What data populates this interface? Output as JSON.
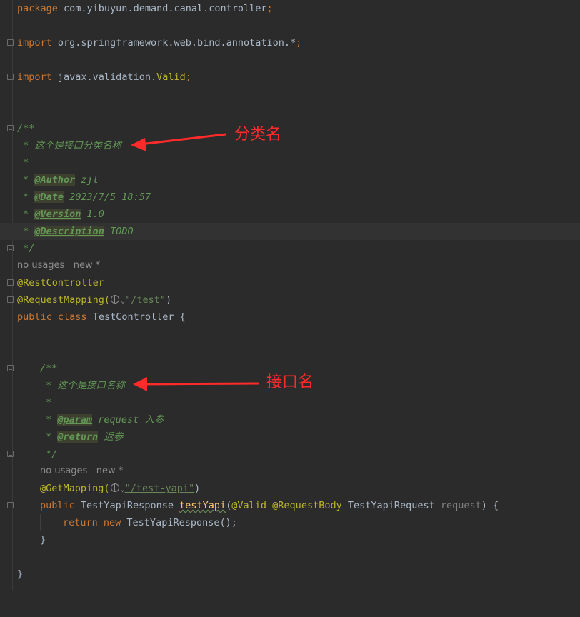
{
  "code": {
    "package_line": "package com.yibuyun.demand.canal.controller;",
    "import1_kw": "import",
    "import1_rest": " org.springframework.web.bind.annotation.*;",
    "import2_kw": "import",
    "import2_pkg": " javax.validation.",
    "import2_cls": "Valid",
    "import2_end": ";",
    "doc_open": "/**",
    "doc_desc": " * 这个是接口分类名称",
    "doc_blank": " *",
    "doc_author_prefix": " * ",
    "doc_author_tag": "@Author",
    "doc_author_val": " zjl",
    "doc_date_tag": "@Date",
    "doc_date_val": " 2023/7/5 18:57",
    "doc_version_tag": "@Version",
    "doc_version_val": " 1.0",
    "doc_descr_tag": "@Description",
    "doc_descr_val": " TODO",
    "doc_close": " */",
    "usages_hint": "no usages",
    "new_hint": "new *",
    "rest_controller": "@RestController",
    "request_mapping": "@RequestMapping(",
    "request_mapping_path": "\"/test\"",
    "request_mapping_end": ")",
    "class_kw1": "public",
    "class_kw2": "class",
    "class_name": " TestController {",
    "m_doc_open": "/**",
    "m_doc_desc": " * 这个是接口名称",
    "m_doc_blank": " *",
    "m_param_tag": "@param",
    "m_param_val": " request 入参",
    "m_return_tag": "@return",
    "m_return_val": " 返参",
    "m_doc_close": " */",
    "m_usages_hint": "no usages",
    "m_new_hint": "new *",
    "get_mapping": "@GetMapping(",
    "get_mapping_path": "\"/test-yapi\"",
    "get_mapping_end": ")",
    "method_kw": "public",
    "method_ret": " TestYapiResponse ",
    "method_name": "testYapi",
    "method_open": "(",
    "method_ann1": "@Valid",
    "method_ann2": " @RequestBody",
    "method_ptype": " TestYapiRequest ",
    "method_pname": "request",
    "method_close": ") {",
    "return_kw": "return",
    "new_kw": " new",
    "return_rest": " TestYapiResponse();",
    "method_end": "}",
    "class_end": "}"
  },
  "annotations": {
    "label1": "分类名",
    "label2": "接口名"
  },
  "colors": {
    "background": "#2b2b2b",
    "keyword": "#cc7832",
    "annotation": "#bbb529",
    "doc_comment": "#629755",
    "string": "#6a8759",
    "method": "#ffc66d",
    "arrow": "#ff2a2a"
  }
}
